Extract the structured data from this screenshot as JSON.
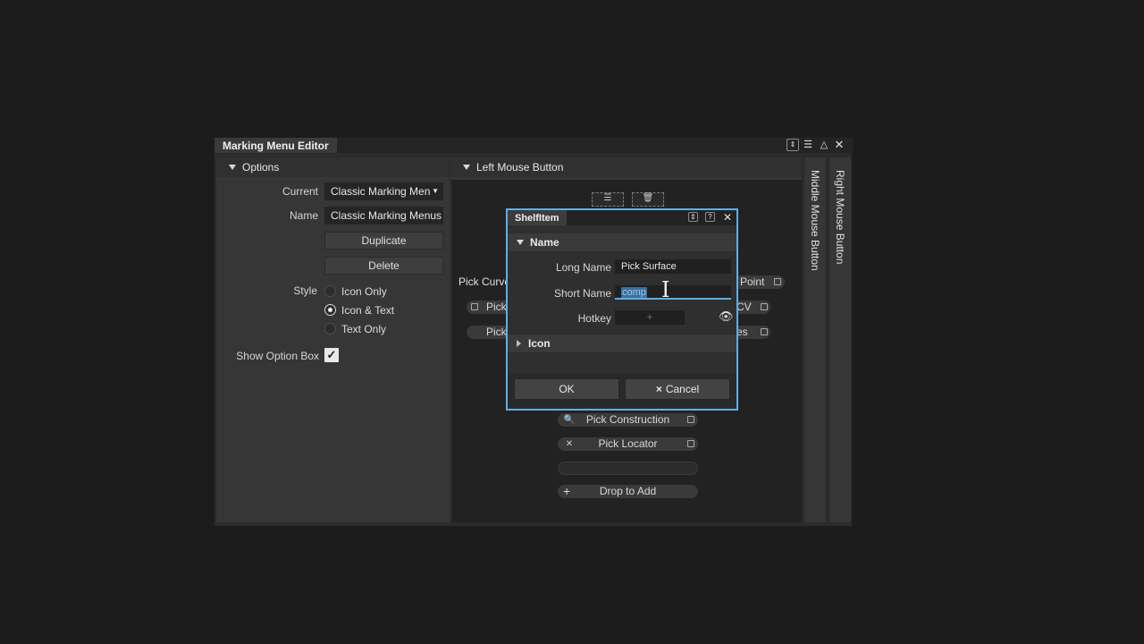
{
  "window": {
    "title": "Marking Menu Editor",
    "controls": [
      "pin-icon",
      "menu-icon",
      "float-icon",
      "close-icon"
    ]
  },
  "options": {
    "header": "Options",
    "current_label": "Current",
    "current_value": "Classic Marking Men",
    "name_label": "Name",
    "name_value": "Classic Marking Menus",
    "duplicate_label": "Duplicate",
    "delete_label": "Delete",
    "style_label": "Style",
    "style_options": [
      "Icon Only",
      "Icon & Text",
      "Text Only"
    ],
    "style_selected": "Icon & Text",
    "show_option_box_label": "Show Option Box",
    "show_option_box_checked": true
  },
  "center": {
    "header": "Left Mouse Button",
    "left_items": [
      "Pick Curve",
      "Pick",
      "Pick"
    ],
    "right_items": [
      "Point",
      "CV",
      "es"
    ],
    "bottom_items": [
      "Pick Construction",
      "Pick Locator",
      "",
      "Drop to Add"
    ]
  },
  "side_tabs": {
    "middle": "Middle Mouse Button",
    "right": "Right Mouse Button"
  },
  "dialog": {
    "title": "ShelfItem",
    "name_section": "Name",
    "long_name_label": "Long Name",
    "long_name_value": "Pick Surface",
    "short_name_label": "Short Name",
    "short_name_value": "comp",
    "hotkey_label": "Hotkey",
    "hotkey_value": "+",
    "icon_section": "Icon",
    "ok_label": "OK",
    "cancel_label": "Cancel",
    "cancel_icon": "×"
  },
  "colors": {
    "dialog_border": "#5bb0e6",
    "selection": "#3d6f9c"
  }
}
